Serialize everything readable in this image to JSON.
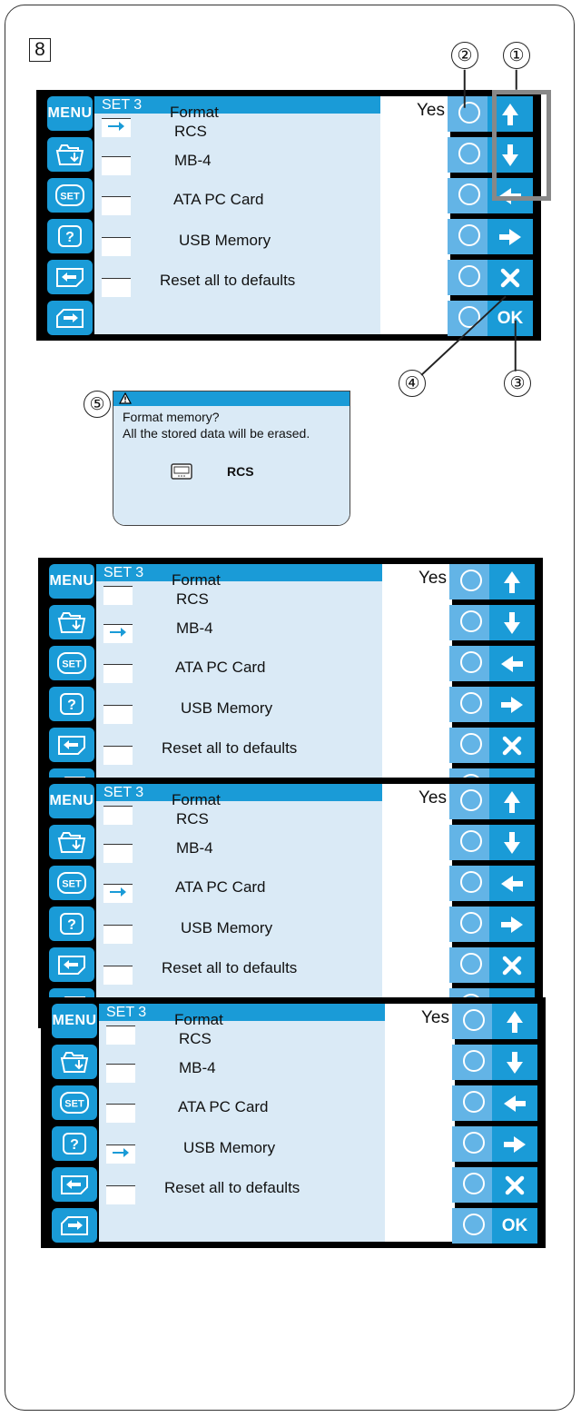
{
  "step_number": "8",
  "callouts": {
    "c1": "①",
    "c2": "②",
    "c3": "③",
    "c4": "④",
    "c5": "⑤"
  },
  "labels": {
    "menu": "MENU",
    "header": "SET 3",
    "yes": "Yes",
    "format": "Format",
    "rcs": "RCS",
    "mb4": "MB-4",
    "ata": "ATA PC Card",
    "usb": "USB Memory",
    "reset": "Reset all to defaults",
    "ok": "OK"
  },
  "left_icons": [
    "menu-button",
    "folder-icon",
    "set-icon",
    "help-icon",
    "back-arrow-icon",
    "forward-arrow-icon"
  ],
  "right_icons": [
    "up-arrow-icon",
    "down-arrow-icon",
    "left-arrow-icon",
    "right-arrow-icon",
    "cancel-x-icon",
    "ok-button"
  ],
  "screens": [
    {
      "selected": "rcs"
    },
    {
      "selected": "mb4"
    },
    {
      "selected": "ata"
    },
    {
      "selected": "usb"
    }
  ],
  "dialog": {
    "line1": "Format memory?",
    "line2": "All the stored data will be erased.",
    "device": "RCS"
  },
  "colors": {
    "accent": "#1a9bd7",
    "panel": "#daeaf6",
    "circle_button": "#63b4e6"
  }
}
